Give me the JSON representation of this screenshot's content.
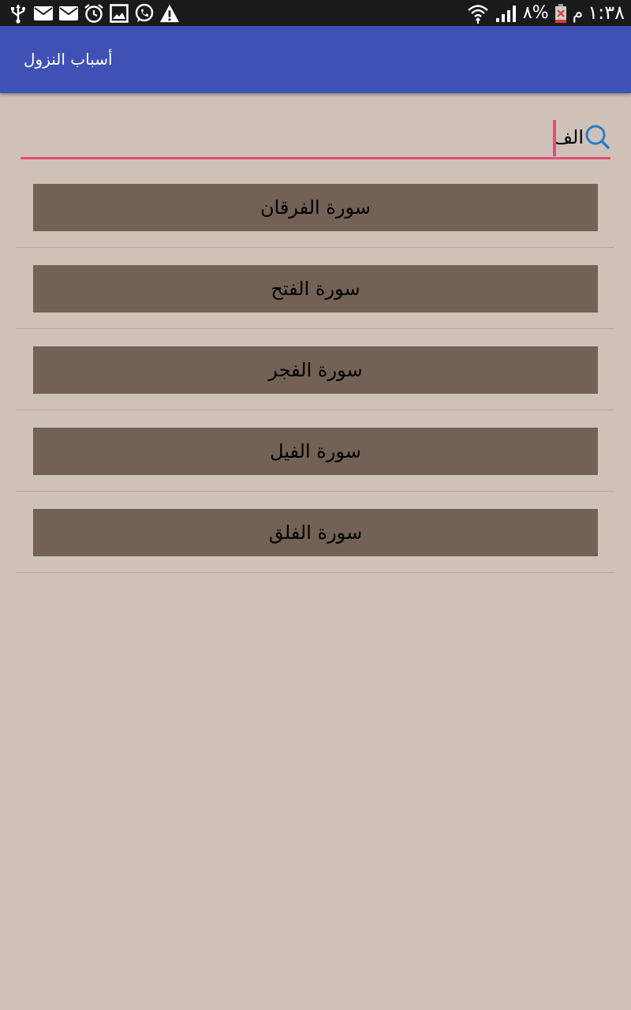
{
  "status_bar": {
    "time": "١:٣٨",
    "ampm": "م",
    "battery": "٨%",
    "icons": [
      "usb-icon",
      "email-icon",
      "email-icon",
      "alarm-icon",
      "image-icon",
      "whatsapp-icon",
      "warning-icon",
      "wifi-icon",
      "signal-icon",
      "battery-icon"
    ]
  },
  "app_bar": {
    "title": "أسباب النزول",
    "color": "#3f51b5"
  },
  "search": {
    "value": "الف",
    "underline_color": "#e84a7a",
    "icon": "search-icon"
  },
  "list": {
    "items": [
      {
        "label": "سورة الفرقان"
      },
      {
        "label": "سورة الفتح"
      },
      {
        "label": "سورة الفجر"
      },
      {
        "label": "سورة الفيل"
      },
      {
        "label": "سورة الفلق"
      }
    ]
  },
  "colors": {
    "background": "#cec1b8",
    "button": "#726154",
    "accent": "#e84a7a"
  }
}
